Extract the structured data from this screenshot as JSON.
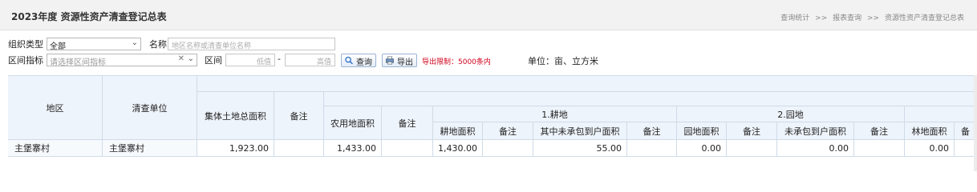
{
  "header": {
    "title": "2023年度 资源性资产清查登记总表",
    "breadcrumb": [
      "查询统计",
      "报表查询",
      "资源性资产清查登记总表"
    ],
    "breadcrumb_sep": ">>"
  },
  "filters": {
    "org_type_label": "组织类型",
    "org_type_value": "全部",
    "name_label": "名称",
    "name_placeholder": "地区名称或清查单位名称",
    "range_indicator_label": "区间指标",
    "range_indicator_placeholder": "请选择区间指标",
    "range_label": "区间",
    "low_placeholder": "低值",
    "dash": "-",
    "high_placeholder": "高值",
    "search_button": "查询",
    "export_button": "导出",
    "export_limit": "导出限制：5000条内",
    "unit": "单位：亩、立方米"
  },
  "table": {
    "headers": {
      "region": "地区",
      "unit": "清查单位",
      "collective_total": "集体土地总面积",
      "remark": "备注",
      "farmland_area": "农用地面积",
      "group_plough": "1.耕地",
      "group_garden": "2.园地",
      "plough_area": "耕地面积",
      "plough_uncontracted": "其中未承包到户面积",
      "garden_area": "园地面积",
      "garden_uncontracted": "未承包到户面积",
      "forest_area": "林地面积",
      "remark_partial": "备"
    },
    "rows": [
      {
        "region": "主堡寨村",
        "unit": "主堡寨村",
        "collective_total": "1,923.00",
        "farmland_area": "1,433.00",
        "plough_area": "1,430.00",
        "plough_uncontracted": "55.00",
        "garden_area": "0.00",
        "garden_uncontracted": "0.00",
        "forest_area": "0.00"
      }
    ]
  },
  "colors": {
    "header_bg": "#eef4fb",
    "border": "#cfdbe8",
    "warning": "#d0021b"
  },
  "icons": [
    "search-icon",
    "export-icon",
    "chevron-down-icon",
    "clear-icon"
  ]
}
